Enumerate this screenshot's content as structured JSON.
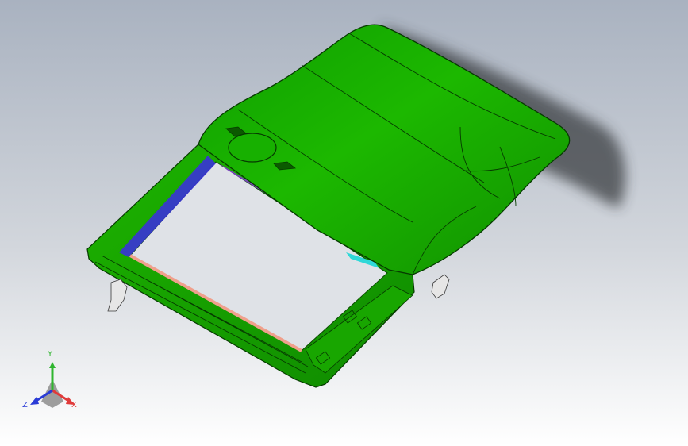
{
  "viewport": {
    "background_top": "#a9b2c0",
    "background_bottom": "#ffffff"
  },
  "model": {
    "body_color": "#17a800",
    "body_dark": "#0c6b00",
    "glass_color": "#dde1e6"
  },
  "triad": {
    "y_label": "Y",
    "x_label": "X",
    "z_label": "Z",
    "y_color": "#2fb52f",
    "x_color": "#e03a3a",
    "z_color": "#2a3bd6"
  }
}
